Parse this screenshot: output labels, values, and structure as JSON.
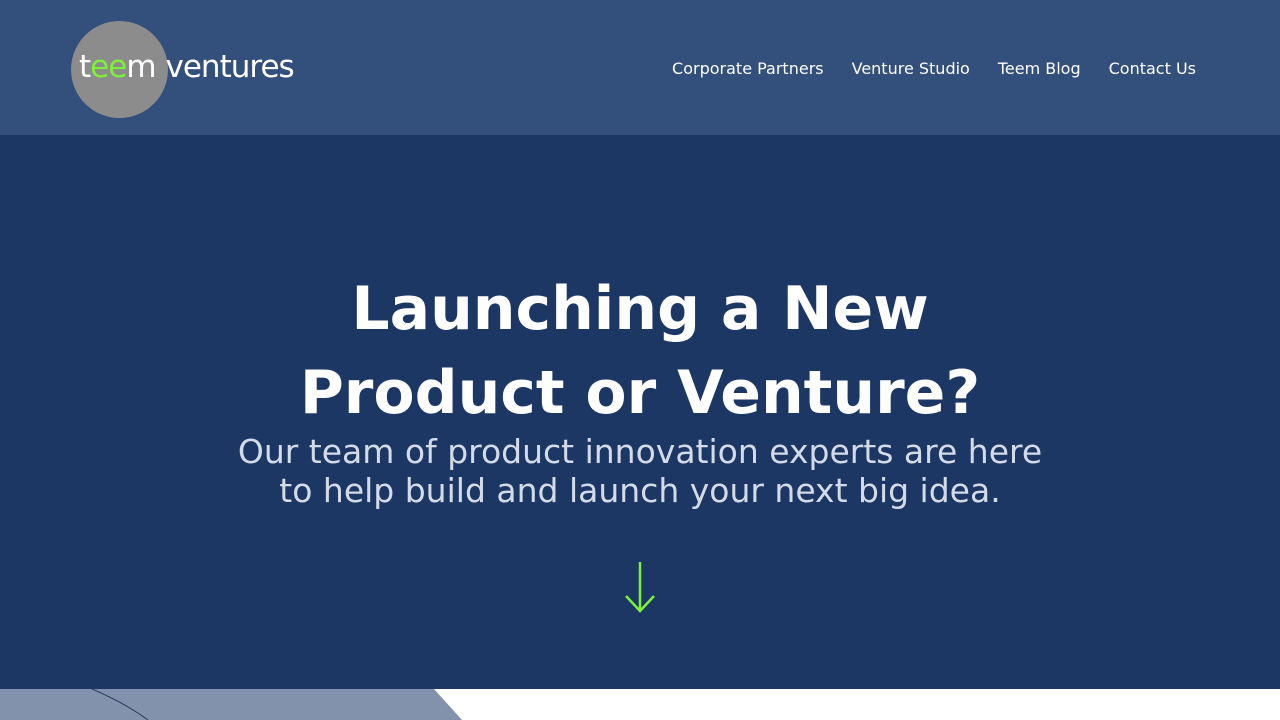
{
  "header": {
    "logo": {
      "part1": "t",
      "part2": "ee",
      "part3": "m",
      "part4": "ventures"
    },
    "nav": [
      {
        "label": "Corporate Partners"
      },
      {
        "label": "Venture Studio"
      },
      {
        "label": "Teem Blog"
      },
      {
        "label": "Contact Us"
      }
    ]
  },
  "hero": {
    "title_line1": "Launching a New",
    "title_line2": "Product or Venture?",
    "subtitle_line1": "Our team of product innovation experts are here",
    "subtitle_line2": "to help build and launch your next big idea."
  },
  "icons": {
    "scroll_arrow": "arrow-down-icon"
  },
  "colors": {
    "header_bg": "#334f7b",
    "hero_bg": "#1d3764",
    "accent_green": "#7df03a",
    "logo_circle": "#8c8c8c"
  }
}
